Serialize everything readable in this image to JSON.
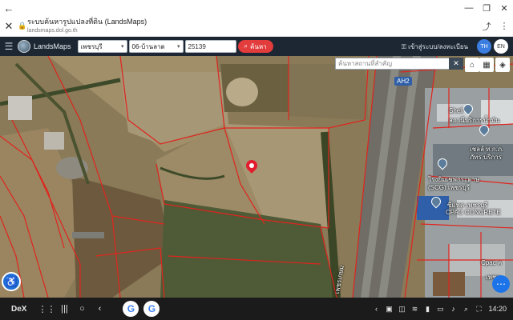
{
  "window": {
    "back_icon": "arrow-left-icon",
    "controls": [
      "minimize-icon",
      "restore-icon",
      "close-icon"
    ]
  },
  "tab": {
    "title": "ระบบค้นหารูปแปลงที่ดิน (LandsMaps)",
    "url": "landsmaps.dol.go.th"
  },
  "navbar": {
    "brand": "LandsMaps",
    "province_select": "เพชรบุรี",
    "district_select": "06-บ้านลาด",
    "parcel_input": "25139",
    "search_button": "ค้นหา",
    "login_label": "เข้าสู่ระบบ/ลงทะเบียน",
    "lang_th": "TH",
    "lang_en": "EN"
  },
  "map": {
    "search_placeholder": "ค้นหาสถานที่สำคัญ",
    "road_badge": "AH2",
    "labels": {
      "shell": "Shell",
      "shell_sub": "สถานีบริการน้ำมัน",
      "petrol": "เชลล์ ท.ก.ภ.",
      "petrol_sub": "ภัทร บริการ",
      "scg": "โรงยิมเชพกระดาษ",
      "scg_sub": "(SCG) เพชรบุรี",
      "cpac_th": "ซีแพค เพชรบุรี",
      "cpac": "CPAC CONCRETE",
      "cpac2": "Cpac ค",
      "road_name": "เพชรเกษม",
      "right_edge": "เพชร"
    }
  },
  "taskbar": {
    "dex": "DeX",
    "time": "14:20"
  },
  "colors": {
    "navbar": "#1d2733",
    "search_button": "#e23c3c",
    "lang_active": "#3b7de0",
    "parcel_line": "#e0241d"
  }
}
